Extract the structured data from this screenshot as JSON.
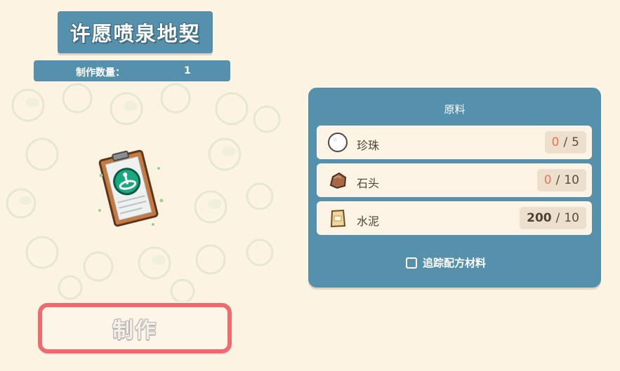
{
  "recipe": {
    "title": "许愿喷泉地契",
    "quantity_label": "制作数量：",
    "quantity_value": "1",
    "item_icon": "deed-blueprint-icon"
  },
  "craft_button": {
    "label": "制作"
  },
  "materials": {
    "title": "原料",
    "items": [
      {
        "name": "珍珠",
        "icon": "pearl-icon",
        "have": "0",
        "need": "5",
        "sufficient": false
      },
      {
        "name": "石头",
        "icon": "stone-icon",
        "have": "0",
        "need": "10",
        "sufficient": false
      },
      {
        "name": "水泥",
        "icon": "cement-bag-icon",
        "have": "200",
        "need": "10",
        "sufficient": true
      }
    ],
    "separator": "/",
    "track_label": "追踪配方材料",
    "track_checked": false
  },
  "colors": {
    "panel": "#5590ad",
    "background": "#fdf3e2",
    "craft_border": "#ef6a6e",
    "insufficient": "#e8735a"
  }
}
